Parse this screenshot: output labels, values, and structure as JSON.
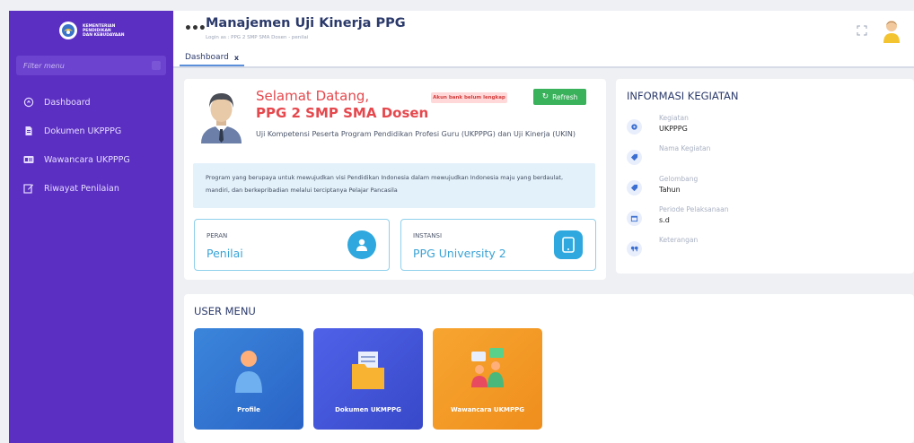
{
  "sidebar": {
    "logo_lines": [
      "KEMENTERIAN",
      "PENDIDIKAN",
      "DAN KEBUDAYAAN"
    ],
    "filter_placeholder": "Filter menu",
    "items": [
      {
        "label": "Dashboard",
        "icon": "clock-icon"
      },
      {
        "label": "Dokumen UKPPPG",
        "icon": "document-icon"
      },
      {
        "label": "Wawancara UKPPPG",
        "icon": "id-card-icon"
      },
      {
        "label": "Riwayat Penilaian",
        "icon": "edit-icon"
      }
    ]
  },
  "header": {
    "title": "Manajemen Uji Kinerja PPG",
    "subtitle": "Login as : PPG 2 SMP SMA Dosen - penilai"
  },
  "tabs": [
    {
      "label": "Dashboard",
      "close": "x"
    }
  ],
  "welcome": {
    "greeting": "Selamat Datang,",
    "name": "PPG 2 SMP SMA Dosen",
    "badge": "Akun bank belum lengkap",
    "refresh_label": "Refresh",
    "description": "Uji Kompetensi Peserta Program Pendidikan Profesi Guru (UKPPPG) dan Uji Kinerja (UKIN)",
    "info": "Program yang berupaya untuk mewujudkan visi Pendidikan Indonesia dalam mewujudkan Indonesia maju yang berdaulat, mandiri, dan berkepribadian melalui terciptanya Pelajar Pancasila",
    "peran_label": "PERAN",
    "peran_value": "Penilai",
    "instansi_label": "INSTANSI",
    "instansi_value": "PPG University 2"
  },
  "info_kegiatan": {
    "title": "INFORMASI KEGIATAN",
    "rows": [
      {
        "key": "Kegiatan",
        "value": "UKPPPG",
        "icon": "gear-icon"
      },
      {
        "key": "Nama Kegiatan",
        "value": "",
        "icon": "tag-icon"
      },
      {
        "key": "Gelombang",
        "value": "Tahun",
        "icon": "tag-icon"
      },
      {
        "key": "Periode Pelaksanaan",
        "value": "s.d",
        "icon": "calendar-icon"
      },
      {
        "key": "Keterangan",
        "value": "",
        "icon": "quote-icon"
      }
    ]
  },
  "user_menu": {
    "title": "USER MENU",
    "tiles": [
      {
        "label": "Profile",
        "icon": "person-icon"
      },
      {
        "label": "Dokumen UKMPPG",
        "icon": "folder-icon"
      },
      {
        "label": "Wawancara UKMPPG",
        "icon": "interview-icon"
      }
    ]
  },
  "colors": {
    "sidebar": "#5b2fc2",
    "accent_red": "#e5484d",
    "accent_blue": "#2ea8de",
    "refresh_green": "#3ab15b"
  }
}
